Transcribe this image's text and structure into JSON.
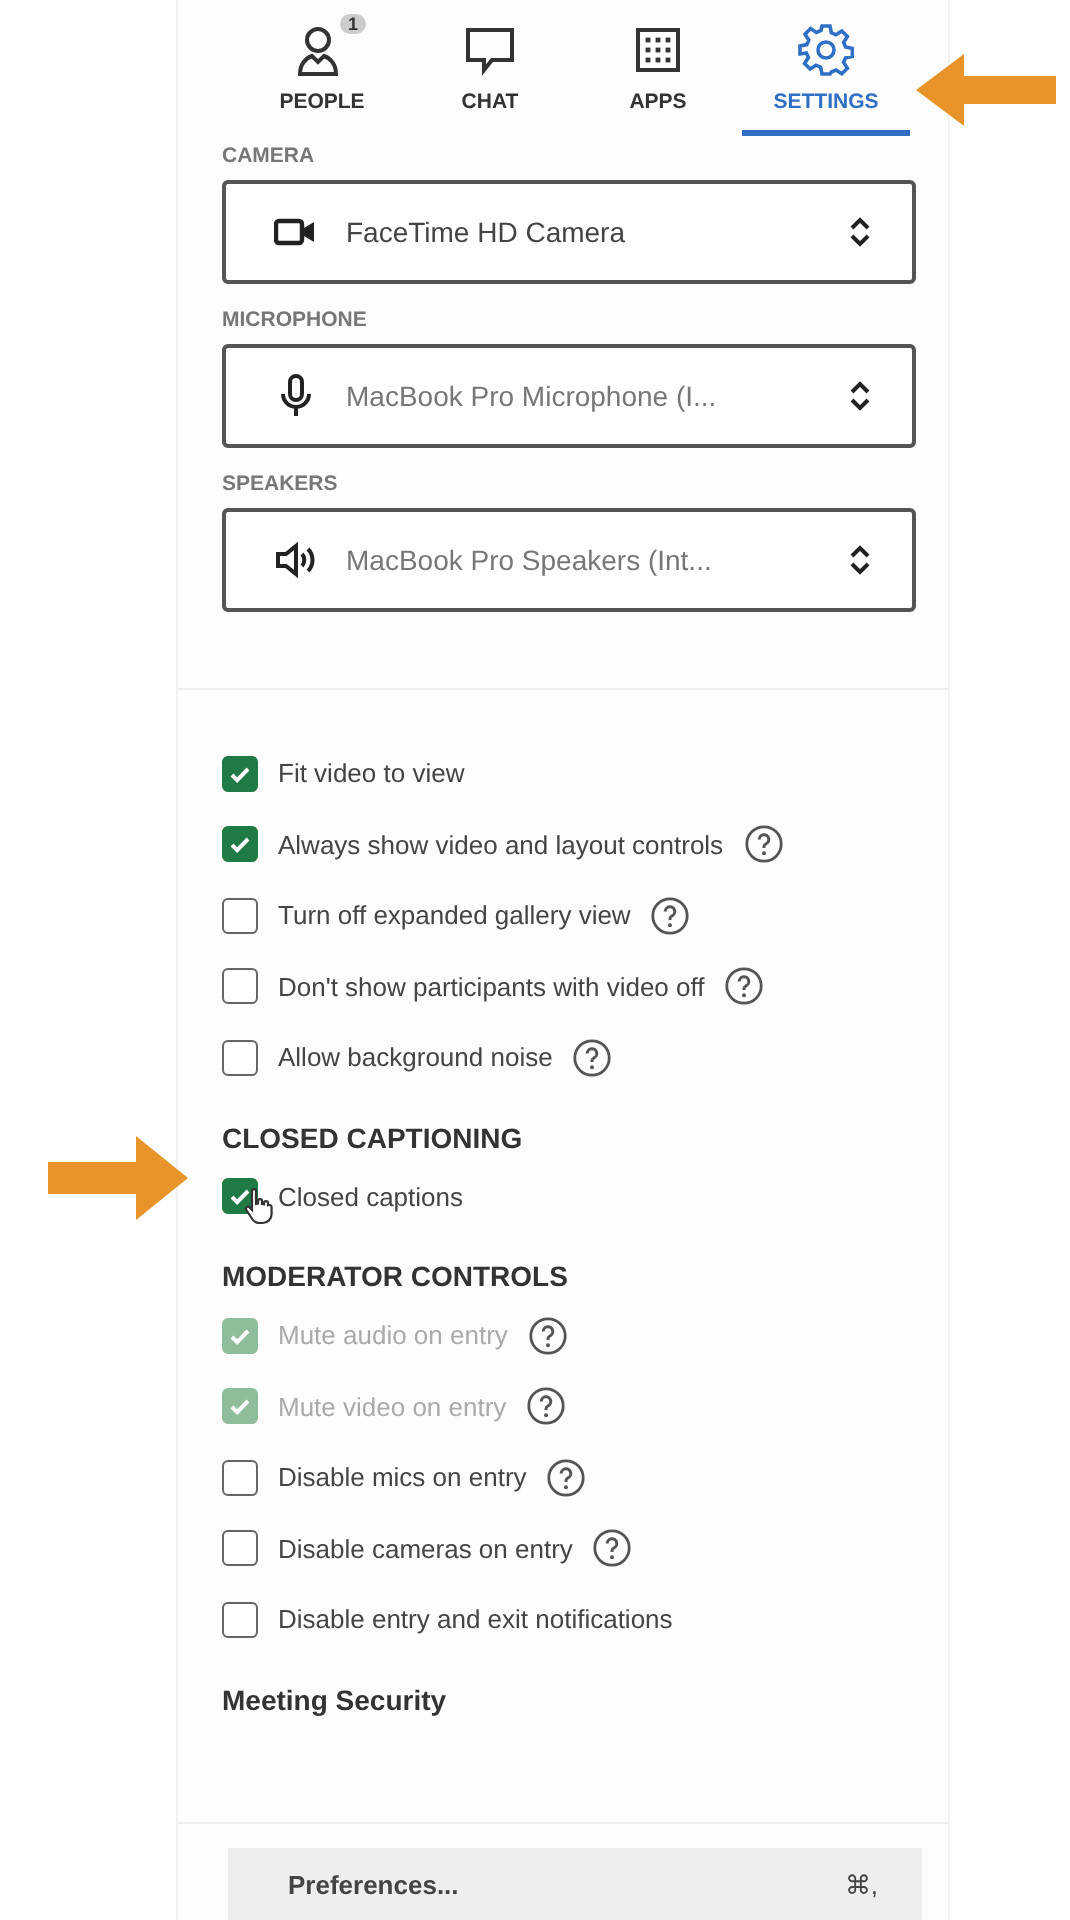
{
  "tabs": [
    {
      "label": "PEOPLE",
      "kind": "people",
      "badge": "1",
      "selected": false
    },
    {
      "label": "CHAT",
      "kind": "chat",
      "selected": false
    },
    {
      "label": "APPS",
      "kind": "apps",
      "selected": false
    },
    {
      "label": "SETTINGS",
      "kind": "settings",
      "selected": true
    }
  ],
  "devices": [
    {
      "label": "CAMERA",
      "kind": "camera",
      "value": "FaceTime HD Camera"
    },
    {
      "label": "MICROPHONE",
      "kind": "microphone",
      "value": "MacBook Pro Microphone (I..."
    },
    {
      "label": "SPEAKERS",
      "kind": "speaker",
      "value": "MacBook Pro Speakers (Int..."
    }
  ],
  "options": [
    {
      "label": "Fit video to view",
      "checked": true,
      "disabled": false,
      "help": false
    },
    {
      "label": "Always show video and layout controls",
      "checked": true,
      "disabled": false,
      "help": true
    },
    {
      "label": "Turn off expanded gallery view",
      "checked": false,
      "disabled": false,
      "help": true
    },
    {
      "label": "Don't show participants with video off",
      "checked": false,
      "disabled": false,
      "help": true
    },
    {
      "label": "Allow background noise",
      "checked": false,
      "disabled": false,
      "help": true
    }
  ],
  "sections": [
    {
      "title": "CLOSED CAPTIONING",
      "options": [
        {
          "label": "Closed captions",
          "checked": true,
          "disabled": false,
          "help": false,
          "hovered": true
        }
      ]
    },
    {
      "title": "MODERATOR CONTROLS",
      "options": [
        {
          "label": "Mute audio on entry",
          "checked": true,
          "disabled": true,
          "help": true
        },
        {
          "label": "Mute video on entry",
          "checked": true,
          "disabled": true,
          "help": true
        },
        {
          "label": "Disable mics on entry",
          "checked": false,
          "disabled": false,
          "help": true
        },
        {
          "label": "Disable cameras on entry",
          "checked": false,
          "disabled": false,
          "help": true
        },
        {
          "label": "Disable entry and exit notifications",
          "checked": false,
          "disabled": false,
          "help": false
        }
      ]
    },
    {
      "title": "Meeting Security"
    }
  ],
  "menu_item": {
    "label": "Preferences...",
    "shortcut": "⌘,"
  }
}
